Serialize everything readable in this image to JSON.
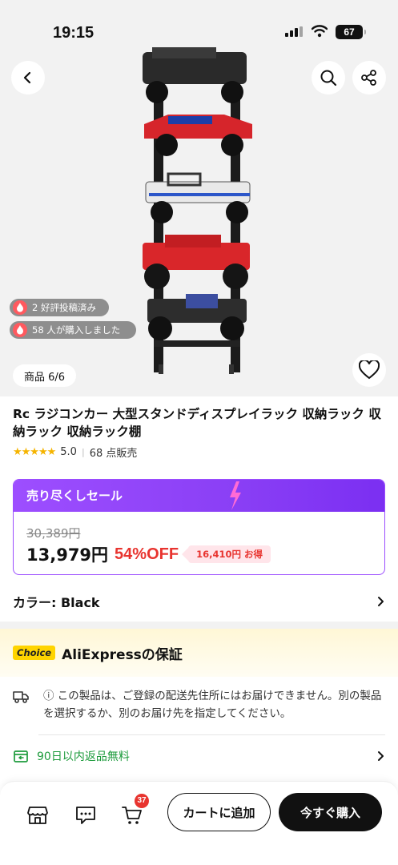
{
  "status": {
    "time": "19:15",
    "battery": "67"
  },
  "hero": {
    "counter": "商品 6/6",
    "badges": [
      {
        "text": "2 好評投稿済み",
        "icon": "flame-icon"
      },
      {
        "text": "58 人が購入しました",
        "icon": "flame-icon"
      }
    ]
  },
  "product": {
    "title": "Rc ラジコンカー 大型スタンドディスプレイラック 収納ラック 収納ラック 収納ラック棚",
    "rating": "5.0",
    "stars": "★★★★★",
    "sold": "68 点販売"
  },
  "sale": {
    "label": "売り尽くしセール",
    "original_price": "30,389円",
    "price": "13,979円",
    "discount": "54%OFF",
    "savings": "16,410円 お得"
  },
  "variant": {
    "label": "カラー: Black"
  },
  "guarantee": {
    "badge": "Choice",
    "title": "AliExpressの保証",
    "notice": "ⓘ この製品は、ご登録の配送先住所にはお届けできません。別の製品を選択するか、別のお届け先を指定してください。",
    "returns": "90日以内返品無料"
  },
  "bottom_bar": {
    "cart_count": "37",
    "add_to_cart": "カートに追加",
    "buy_now": "今すぐ購入"
  },
  "colors": {
    "sale_purple": "#9d4eff",
    "discount_red": "#e8342f",
    "choice_yellow": "#ffd400",
    "returns_green": "#1d9b3c"
  }
}
